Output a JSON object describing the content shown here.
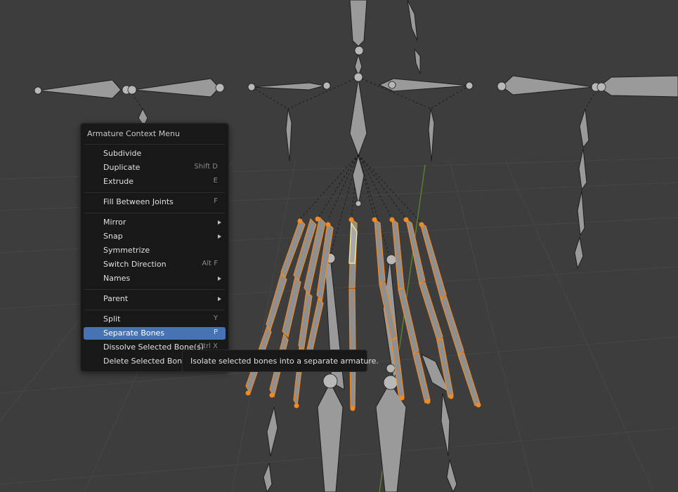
{
  "viewport": {
    "grid_color": "#4a4a4a",
    "bone_color": "#9a9a9a",
    "bone_edge_color": "#1e1e1e",
    "selected_bone_color": "#f08a24",
    "active_bone_color": "#f5e58a"
  },
  "context_menu": {
    "title": "Armature Context Menu",
    "items": [
      {
        "label": "Subdivide",
        "shortcut": ""
      },
      {
        "label": "Duplicate",
        "shortcut": "Shift D"
      },
      {
        "label": "Extrude",
        "shortcut": "E"
      },
      {
        "label": "Fill Between Joints",
        "shortcut": "F"
      },
      {
        "label": "Mirror",
        "shortcut": ""
      },
      {
        "label": "Snap",
        "shortcut": ""
      },
      {
        "label": "Symmetrize",
        "shortcut": ""
      },
      {
        "label": "Switch Direction",
        "shortcut": "Alt F"
      },
      {
        "label": "Names",
        "shortcut": ""
      },
      {
        "label": "Parent",
        "shortcut": ""
      },
      {
        "label": "Split",
        "shortcut": "Y"
      },
      {
        "label": "Separate Bones",
        "shortcut": "P"
      },
      {
        "label": "Dissolve Selected Bone(s)",
        "shortcut": "Ctrl X"
      },
      {
        "label": "Delete Selected Bone(s)",
        "shortcut": ""
      }
    ],
    "highlight_color": "#4772b3"
  },
  "tooltip": {
    "text": "Isolate selected bones into a separate armature."
  }
}
